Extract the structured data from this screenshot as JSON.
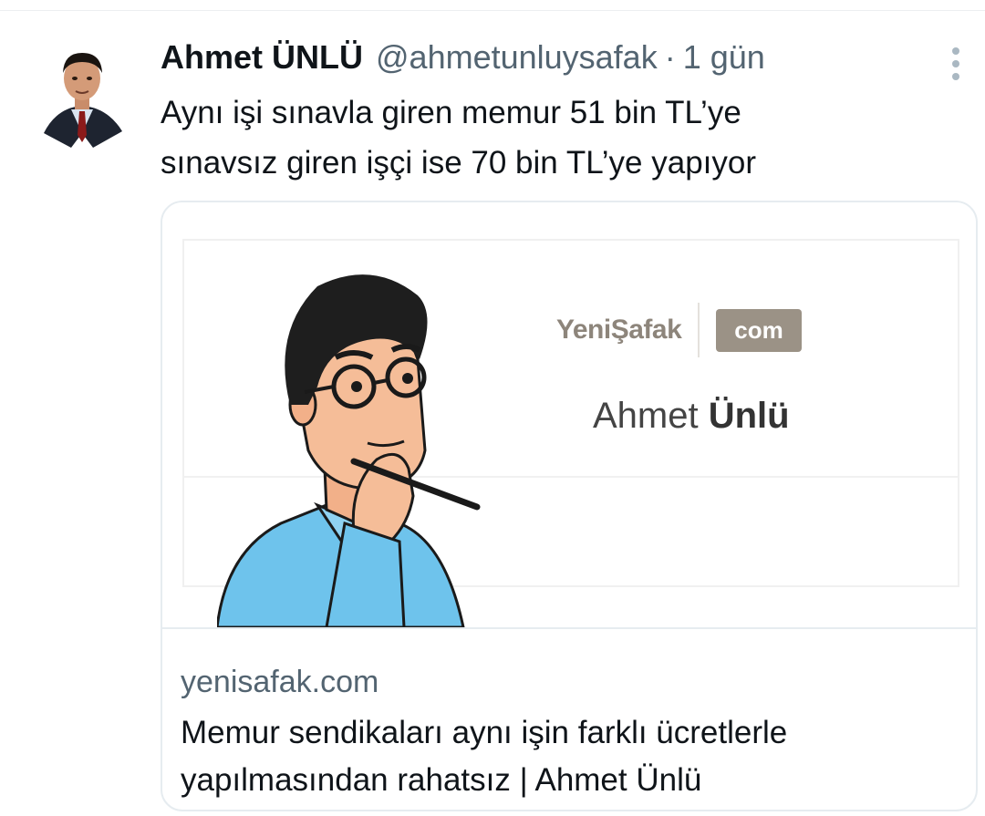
{
  "tweet": {
    "author_name": "Ahmet ÜNLÜ",
    "author_handle": "@ahmetunluysafak",
    "separator": "·",
    "time": "1 gün",
    "text_line1": "Aynı işi sınavla giren memur 51 bin TL’ye",
    "text_line2": "sınavsız giren işçi ise 70 bin TL’ye yapıyor"
  },
  "card": {
    "brand_name": "YeniŞafak",
    "brand_badge": "com",
    "author_first": "Ahmet ",
    "author_last": "Ünlü",
    "domain": "yenisafak.com",
    "title_line1": "Memur sendikaları aynı işin farklı ücretlerle",
    "title_line2": "yapılmasından rahatsız | Ahmet Ünlü"
  },
  "icons": {
    "more": "more-vertical-icon"
  },
  "colors": {
    "text": "#0f1419",
    "secondary": "#536471",
    "brand": "#8d857b",
    "badge": "#9b9286",
    "shirt": "#6ec3ec"
  }
}
